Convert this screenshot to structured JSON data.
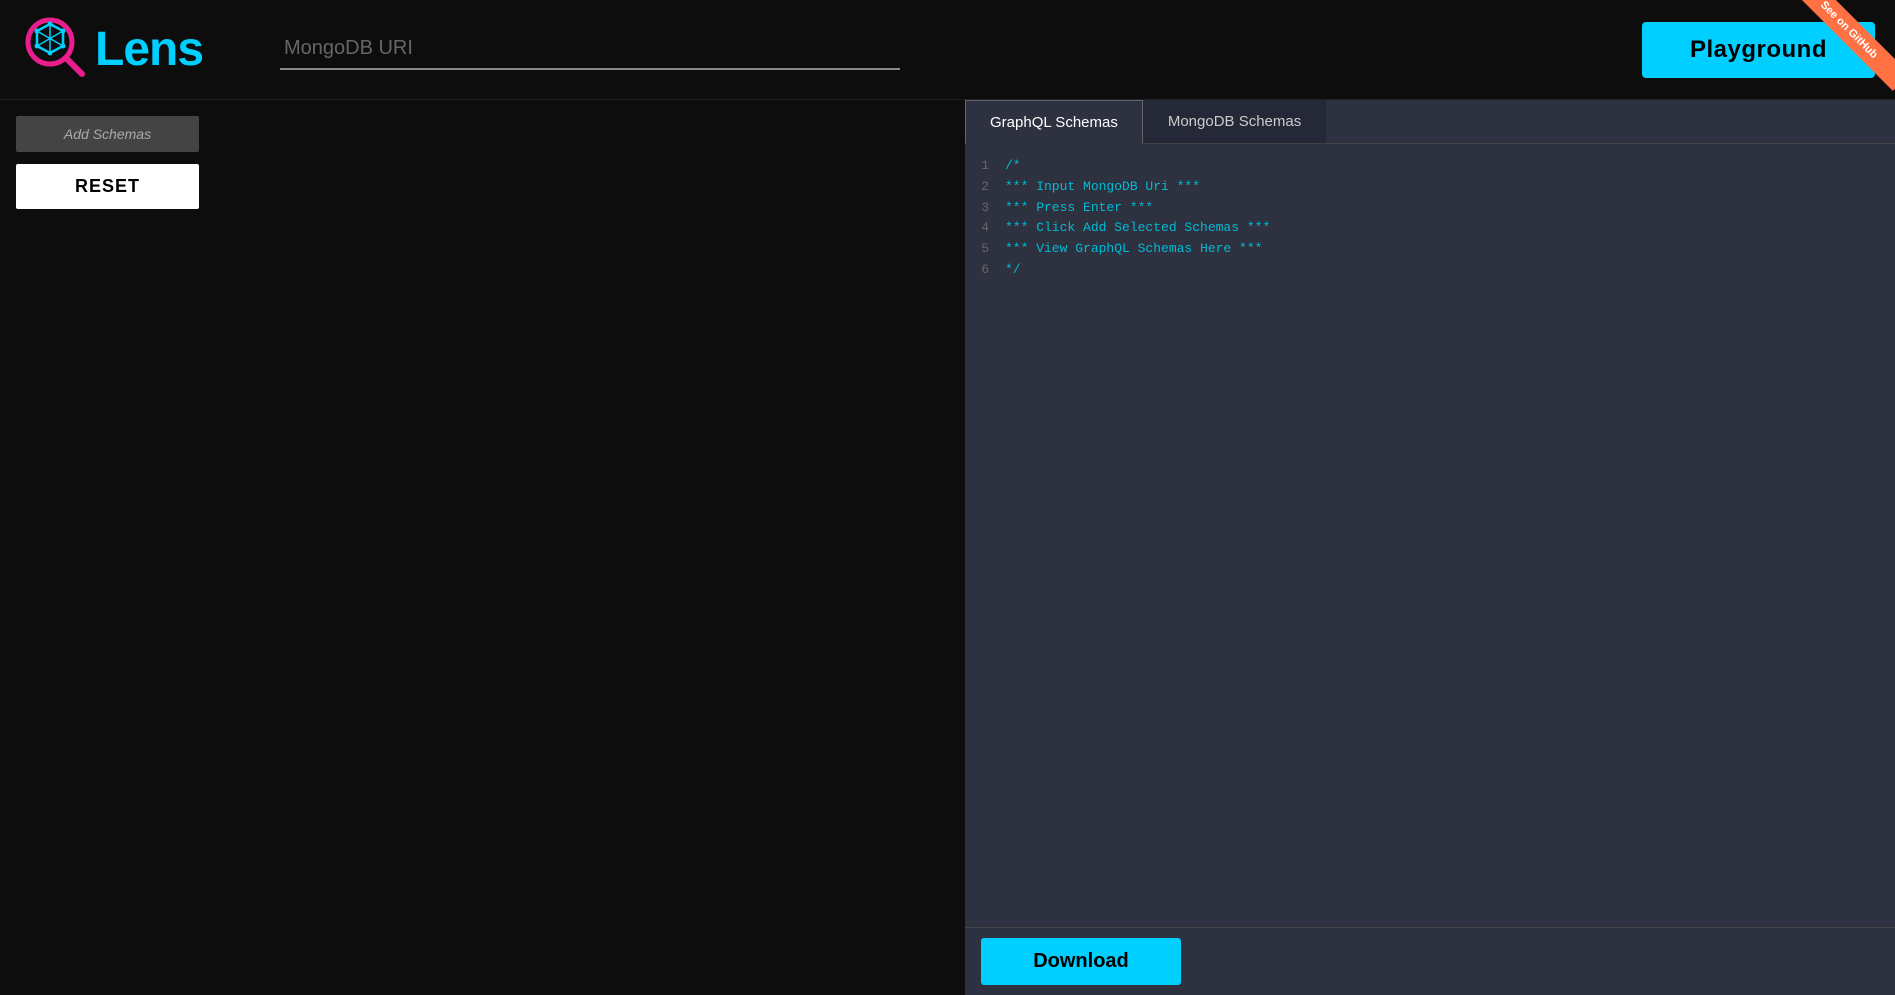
{
  "header": {
    "logo_text": "Lens",
    "uri_placeholder": "MongoDB URI",
    "playground_label": "Playground"
  },
  "github": {
    "ribbon_text": "See on GitHub"
  },
  "sidebar": {
    "add_schema_label": "Add Schemas",
    "reset_label": "RESET"
  },
  "schema_panel": {
    "tabs": [
      {
        "id": "graphql",
        "label": "GraphQL Schemas",
        "active": true
      },
      {
        "id": "mongodb",
        "label": "MongoDB Schemas",
        "active": false
      }
    ],
    "code_lines": [
      {
        "num": "1",
        "content": "/*"
      },
      {
        "num": "2",
        "content": "*** Input MongoDB Uri ***"
      },
      {
        "num": "3",
        "content": "*** Press Enter ***"
      },
      {
        "num": "4",
        "content": "*** Click Add Selected Schemas ***"
      },
      {
        "num": "5",
        "content": "*** View GraphQL Schemas Here ***"
      },
      {
        "num": "6",
        "content": "*/"
      }
    ],
    "download_label": "Download"
  },
  "colors": {
    "accent_cyan": "#00cfff",
    "accent_pink": "#e91e8c",
    "background_dark": "#0d0d0d",
    "panel_dark": "#2e3140",
    "github_ribbon": "#ff7043"
  }
}
